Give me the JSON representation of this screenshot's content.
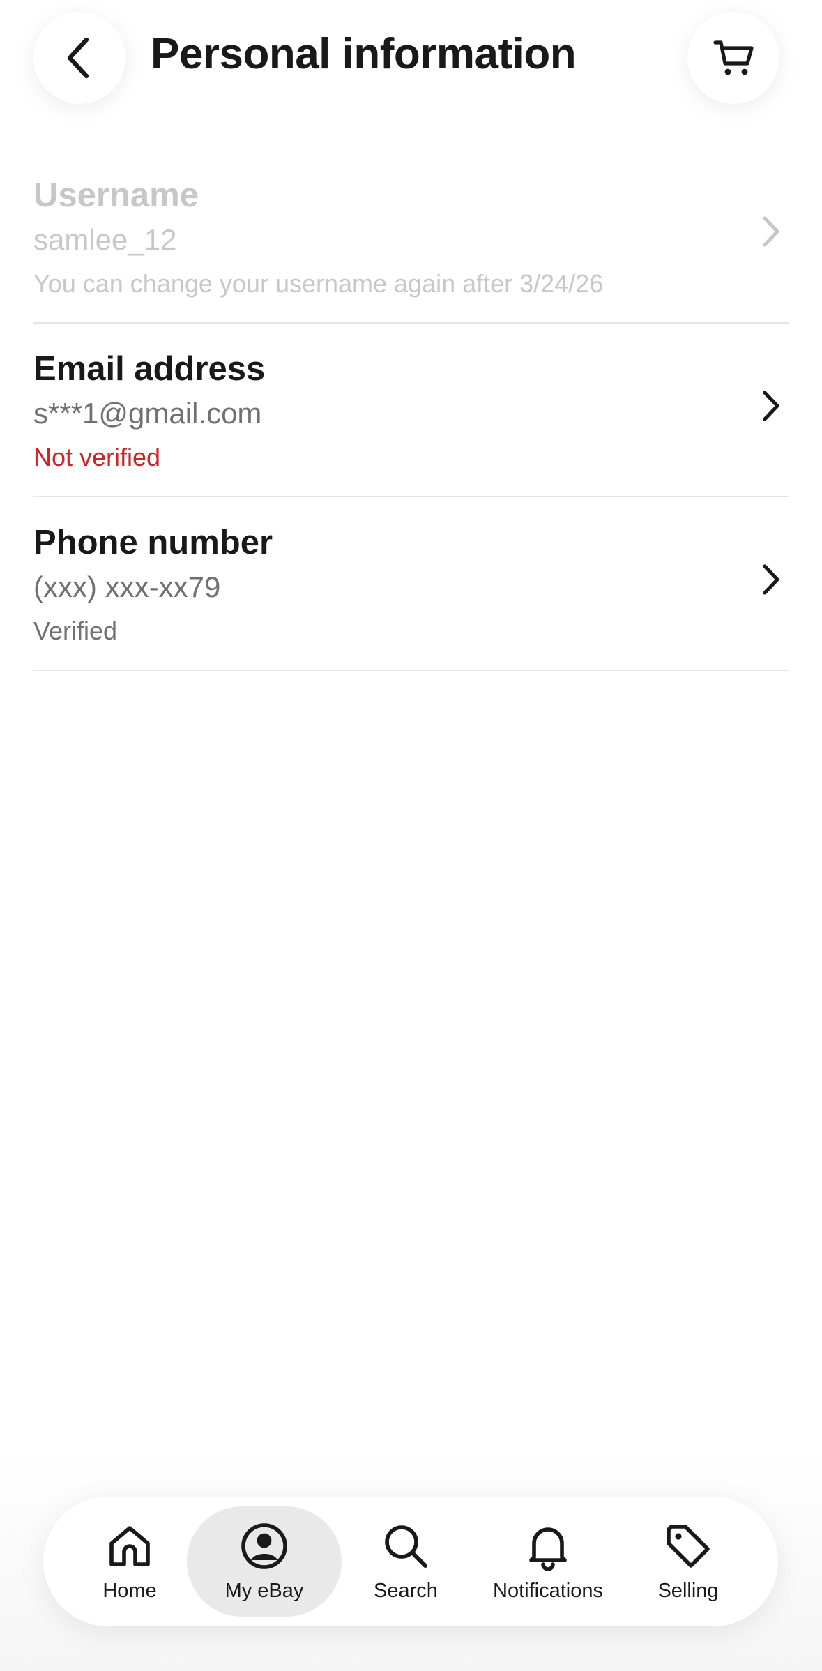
{
  "header": {
    "title": "Personal information",
    "back_icon": "chevron-left-icon",
    "cart_icon": "cart-icon"
  },
  "rows": [
    {
      "title": "Username",
      "value": "samlee_12",
      "status": "You can change your username again after 3/24/26",
      "disabled": true
    },
    {
      "title": "Email address",
      "value": "s***1@gmail.com",
      "status": "Not verified",
      "status_color": "#c9252c"
    },
    {
      "title": "Phone number",
      "value": "(xxx) xxx-xx79",
      "status": "Verified"
    }
  ],
  "tabbar": {
    "tabs": [
      {
        "label": "Home",
        "icon": "home-icon"
      },
      {
        "label": "My eBay",
        "icon": "account-icon",
        "active": true
      },
      {
        "label": "Search",
        "icon": "search-icon"
      },
      {
        "label": "Notifications",
        "icon": "bell-icon"
      },
      {
        "label": "Selling",
        "icon": "tag-icon"
      }
    ]
  },
  "colors": {
    "text": "#191919",
    "secondary": "#707070",
    "disabled": "#c7c7c7",
    "error": "#c9252c",
    "active_tab_bg": "#e9e9e9"
  }
}
